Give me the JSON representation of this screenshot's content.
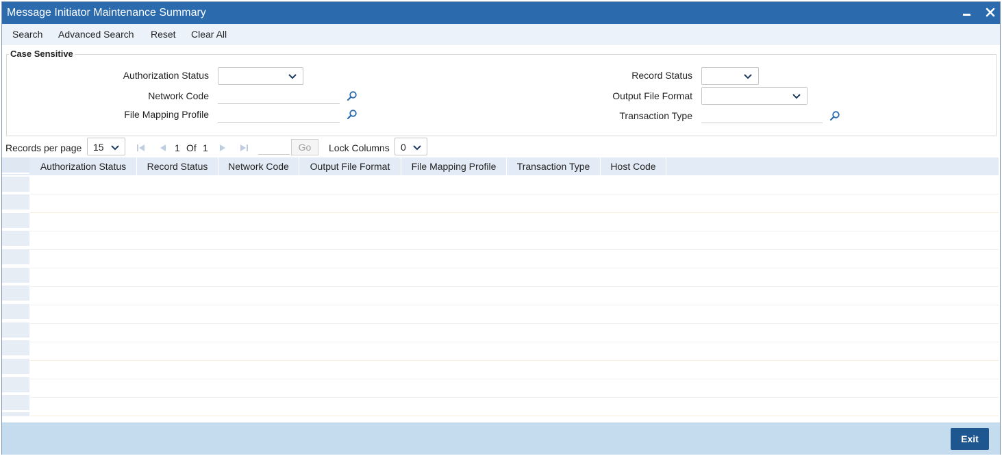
{
  "window": {
    "title": "Message Initiator Maintenance Summary"
  },
  "toolbar": {
    "search": "Search",
    "advanced_search": "Advanced Search",
    "reset": "Reset",
    "clear_all": "Clear All"
  },
  "criteria": {
    "legend": "Case Sensitive",
    "authorization_status": {
      "label": "Authorization Status",
      "value": ""
    },
    "network_code": {
      "label": "Network Code",
      "value": ""
    },
    "file_mapping_profile": {
      "label": "File Mapping Profile",
      "value": ""
    },
    "record_status": {
      "label": "Record Status",
      "value": ""
    },
    "output_file_format": {
      "label": "Output File Format",
      "value": ""
    },
    "transaction_type": {
      "label": "Transaction Type",
      "value": ""
    }
  },
  "pager": {
    "records_per_page_label": "Records per page",
    "records_per_page": "15",
    "current_page": "1",
    "of_label": "Of",
    "total_pages": "1",
    "go_label": "Go",
    "lock_columns_label": "Lock Columns",
    "lock_columns": "0"
  },
  "grid": {
    "columns": [
      "Authorization Status",
      "Record Status",
      "Network Code",
      "Output File Format",
      "File Mapping Profile",
      "Transaction Type",
      "Host Code"
    ],
    "rows": []
  },
  "footer": {
    "exit": "Exit"
  },
  "colors": {
    "title_bar": "#2a6aad",
    "toolbar_bg": "#ecf2fa",
    "footer_bg": "#c4dcee",
    "exit_button": "#1e5690",
    "icon": "#2a6aad"
  },
  "icons": [
    "minimize-icon",
    "close-icon",
    "chevron-down-icon",
    "search-lookup-icon",
    "first-page-icon",
    "previous-page-icon",
    "next-page-icon",
    "last-page-icon"
  ]
}
